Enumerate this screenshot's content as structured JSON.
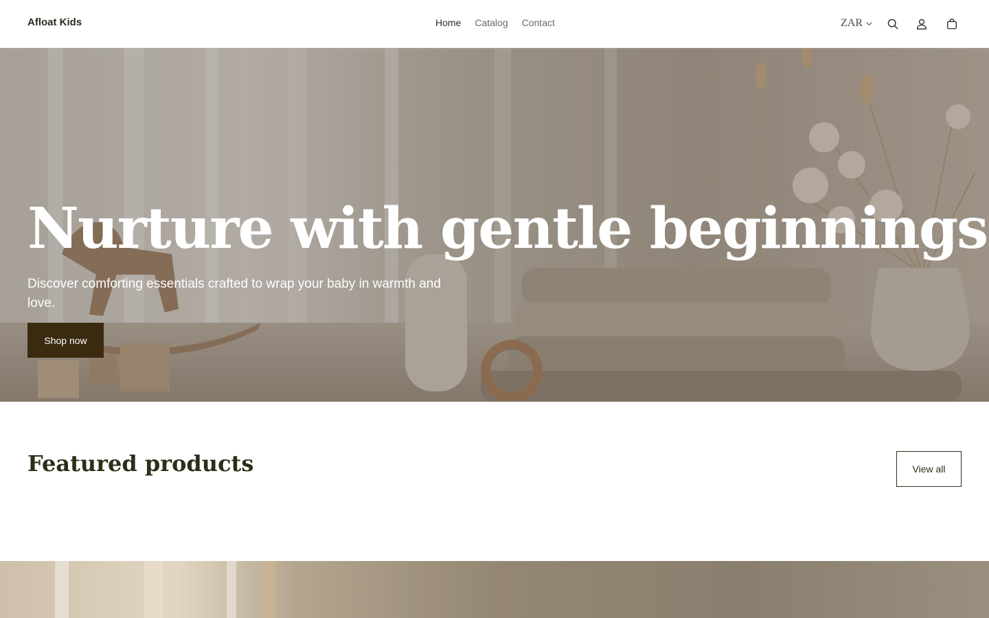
{
  "header": {
    "brand": "Afloat Kids",
    "nav": [
      {
        "label": "Home",
        "active": true
      },
      {
        "label": "Catalog",
        "active": false
      },
      {
        "label": "Contact",
        "active": false
      }
    ],
    "currency": "ZAR",
    "icons": [
      "chevron-down-icon",
      "search-icon",
      "account-icon",
      "cart-icon"
    ]
  },
  "hero": {
    "title": "Nurture with gentle beginnings",
    "subtitle": "Discover comforting essentials crafted to wrap your baby in warmth and love.",
    "cta": "Shop now"
  },
  "featured": {
    "title": "Featured products",
    "view_all": "View all"
  },
  "colors": {
    "brand_dark": "#3a2a10",
    "heading": "#2e2e18",
    "nav_muted": "#6b6a5e"
  }
}
